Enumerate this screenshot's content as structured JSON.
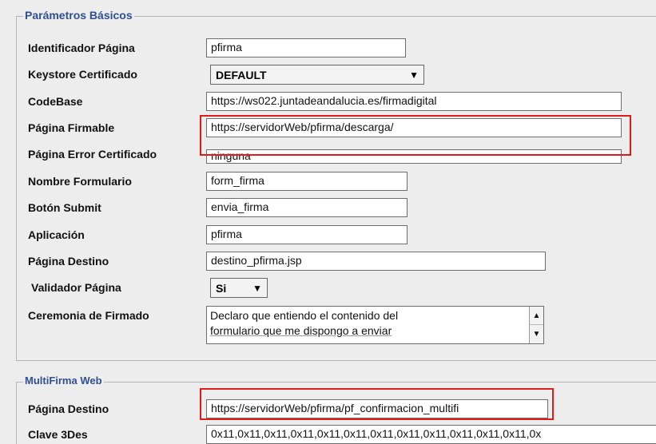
{
  "basic": {
    "legend": "Parámetros Básicos",
    "identificador_label": "Identificador Página",
    "identificador_value": "pfirma",
    "keystore_label": "Keystore Certificado",
    "keystore_value": "DEFAULT",
    "codebase_label": "CodeBase",
    "codebase_value": "https://ws022.juntadeandalucia.es/firmadigital",
    "firmable_label": "Página Firmable",
    "firmable_value": "https://servidorWeb/pfirma/descarga/",
    "error_label": "Página Error Certificado",
    "error_value": "ninguna",
    "nombre_form_label": "Nombre Formulario",
    "nombre_form_value": "form_firma",
    "submit_label": "Botón Submit",
    "submit_value": "envia_firma",
    "aplicacion_label": "Aplicación",
    "aplicacion_value": "pfirma",
    "destino_label": "Página Destino",
    "destino_value": "destino_pfirma.jsp",
    "validador_label": "Validador Página",
    "validador_value": "Si",
    "ceremonia_label": "Ceremonia de Firmado",
    "ceremonia_line1": "Declaro que entiendo el contenido del",
    "ceremonia_line2": "formulario que me dispongo a enviar"
  },
  "multi": {
    "legend": "MultiFirma Web",
    "destino_label": "Página Destino",
    "destino_value": "https://servidorWeb/pfirma/pf_confirmacion_multifi",
    "clave_label": "Clave 3Des",
    "clave_value": "0x11,0x11,0x11,0x11,0x11,0x11,0x11,0x11,0x11,0x11,0x11,0x11,0x"
  },
  "icons": {
    "dropdown": "chevron-down-icon",
    "scroll_up": "scroll-up-icon",
    "scroll_down": "scroll-down-icon"
  },
  "colors": {
    "legend": "#2f4f93",
    "highlight": "#e11b1b"
  }
}
